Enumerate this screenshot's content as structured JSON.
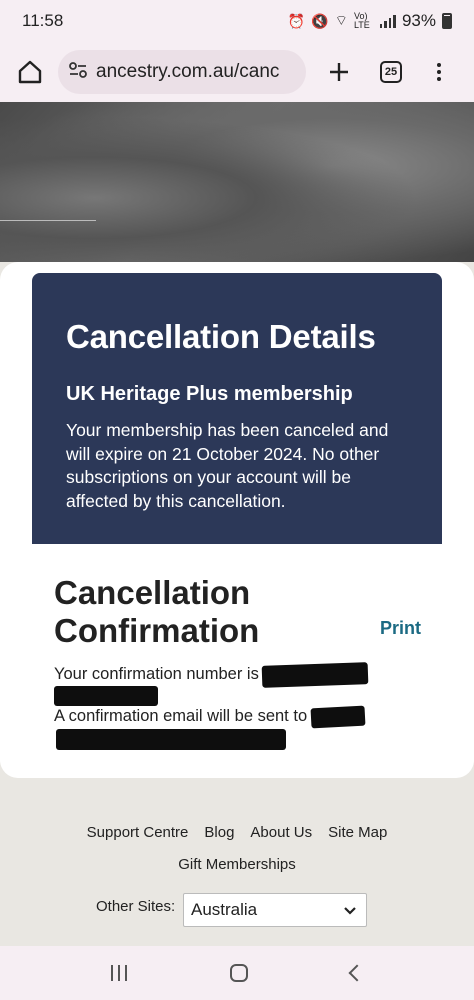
{
  "status_bar": {
    "time": "11:58",
    "battery": "93%",
    "network": "Vo) LTE"
  },
  "browser": {
    "url": "ancestry.com.au/canc",
    "tab_count": "25",
    "icons": [
      "home-icon",
      "site-settings-icon",
      "plus-icon",
      "tabs-icon",
      "more-vert-icon"
    ]
  },
  "details": {
    "title": "Cancellation Details",
    "subtitle": "UK Heritage Plus membership",
    "body": "Your membership has been canceled and will expire on 21 October 2024. No other subscriptions on your account will be affected by this cancellation."
  },
  "confirmation": {
    "title": "Cancellation Confirmation",
    "print_label": "Print",
    "number_text": "Your confirmation number is",
    "email_text": "A confirmation email will be sent to"
  },
  "footer": {
    "links": [
      "Support Centre",
      "Blog",
      "About Us",
      "Site Map"
    ],
    "links_row2": [
      "Gift Memberships"
    ],
    "other_sites_label": "Other Sites:",
    "other_sites_value": "Australia"
  },
  "colors": {
    "details_bg": "#2c3858",
    "print_link": "#1b6a83",
    "page_bg": "#e9e7e2",
    "chrome_bg": "#f6eef3"
  }
}
